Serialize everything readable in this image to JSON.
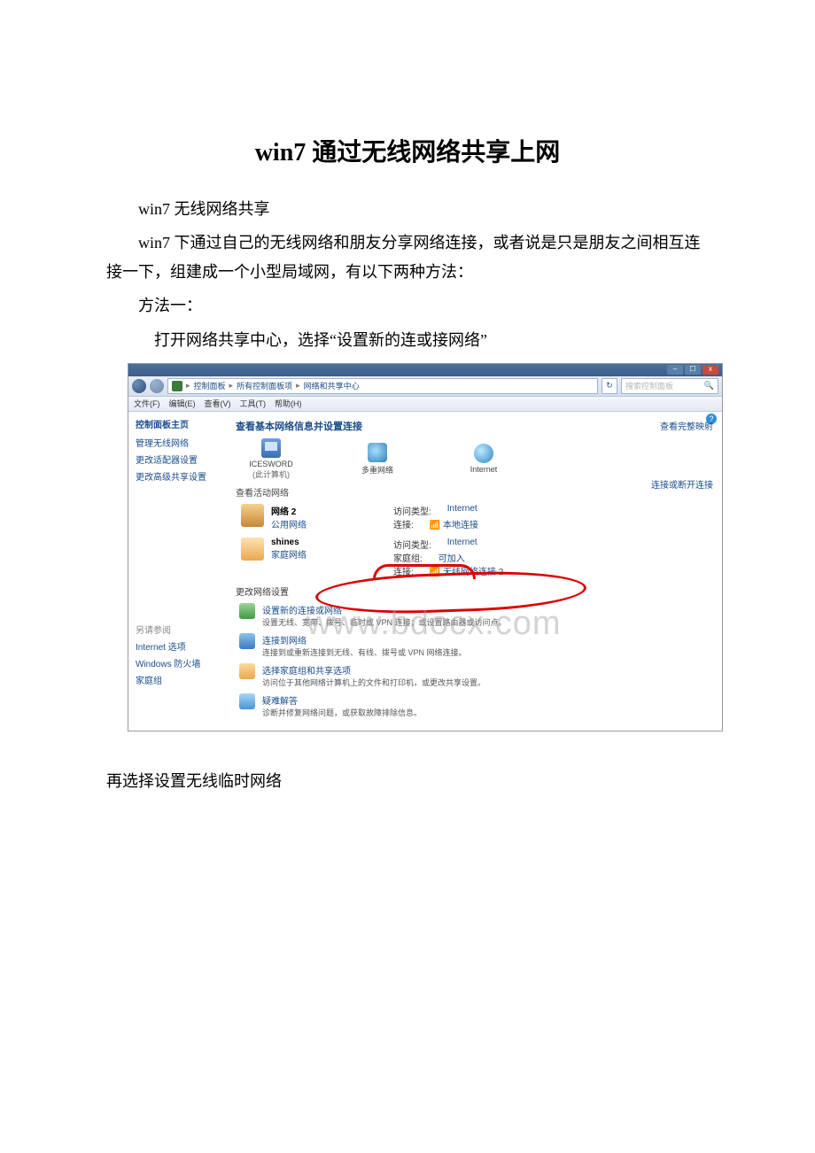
{
  "doc": {
    "title": "win7 通过无线网络共享上网",
    "p1": "win7 无线网络共享",
    "p2": "win7 下通过自己的无线网络和朋友分享网络连接，或者说是只是朋友之间相互连接一下，组建成一个小型局域网，有以下两种方法：",
    "p3": "方法一：",
    "p4": "打开网络共享中心，选择“设置新的连或接网络”",
    "p5": "再选择设置无线临时网络"
  },
  "win": {
    "addr": {
      "seg1": "控制面板",
      "seg2": "所有控制面板项",
      "seg3": "网络和共享中心"
    },
    "refresh": "↻",
    "searchPlaceholder": "搜索控制面板",
    "menu": {
      "file": "文件(F)",
      "edit": "编辑(E)",
      "view": "查看(V)",
      "tools": "工具(T)",
      "help": "帮助(H)"
    },
    "side": {
      "head": "控制面板主页",
      "l1": "管理无线网络",
      "l2": "更改适配器设置",
      "l3": "更改高级共享设置",
      "rel0": "另请参阅",
      "rel1": "Internet 选项",
      "rel2": "Windows 防火墙",
      "rel3": "家庭组"
    },
    "main": {
      "h1": "查看基本网络信息并设置连接",
      "pcName": "ICESWORD",
      "pcSub": "(此计算机)",
      "midName": "多重网络",
      "netName": "Internet",
      "viewMap": "查看完整映射",
      "viewActive": "查看活动网络",
      "connLink": "连接或断开连接",
      "n1": {
        "name": "网络 2",
        "type": "公用网络",
        "k1": "访问类型:",
        "v1": "Internet",
        "k2": "连接:",
        "v2": "本地连接"
      },
      "n2": {
        "name": "shines",
        "type": "家庭网络",
        "k1": "访问类型:",
        "v1": "Internet",
        "k2": "家庭组:",
        "v2": "可加入",
        "k3": "连接:",
        "v3": "无线网络连接 2"
      },
      "changeTitle": "更改网络设置",
      "a1t": "设置新的连接或网络",
      "a1d": "设置无线、宽带、拨号、临时或 VPN 连接；或设置路由器或访问点。",
      "a2t": "连接到网络",
      "a2d": "连接到或重新连接到无线、有线、拨号或 VPN 网络连接。",
      "a3t": "选择家庭组和共享选项",
      "a3d": "访问位于其他网络计算机上的文件和打印机，或更改共享设置。",
      "a4t": "疑难解答",
      "a4d": "诊断并修复网络问题，或获取故障排除信息。"
    }
  },
  "watermark": "www.bdocx.com"
}
